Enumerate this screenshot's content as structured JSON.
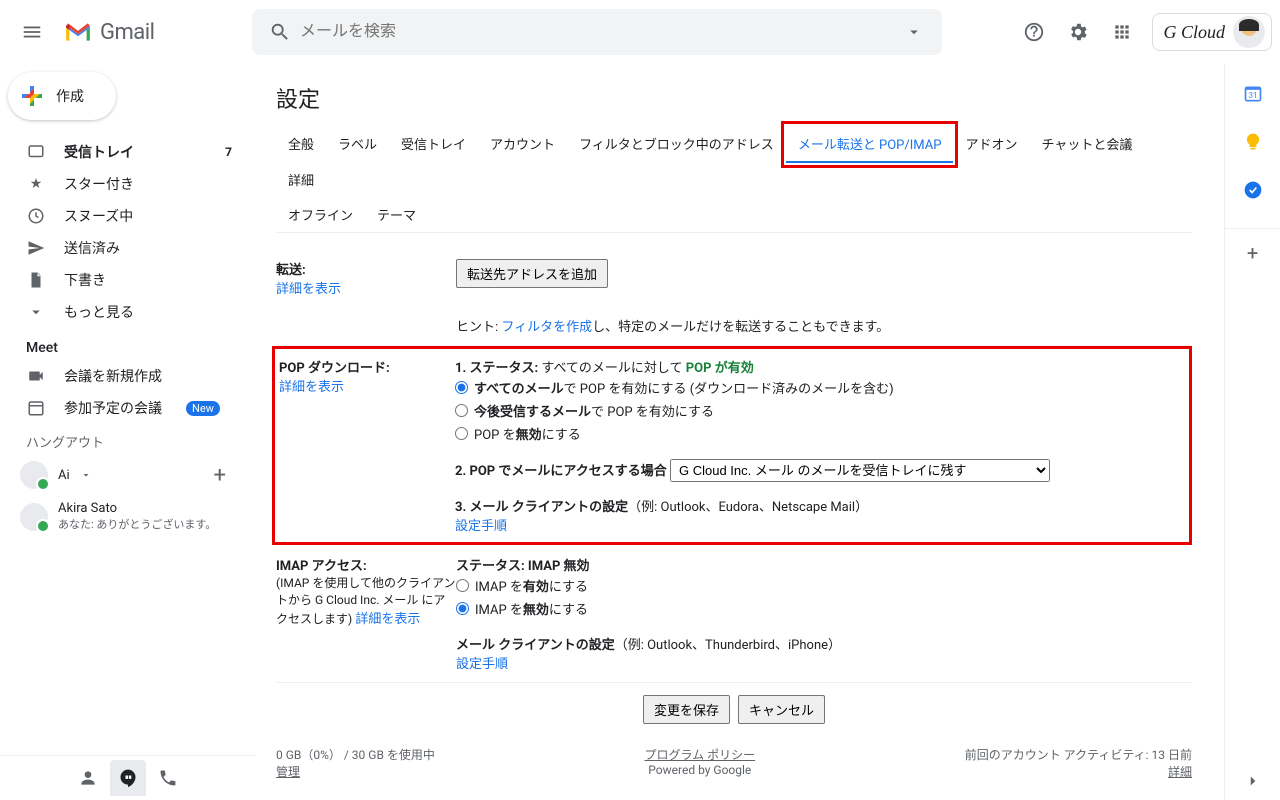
{
  "header": {
    "product": "Gmail",
    "search_placeholder": "メールを検索",
    "account_name": "G Cloud"
  },
  "sidebar": {
    "compose": "作成",
    "items": [
      {
        "icon": "inbox",
        "label": "受信トレイ",
        "count": "7",
        "bold": true
      },
      {
        "icon": "star",
        "label": "スター付き"
      },
      {
        "icon": "clock",
        "label": "スヌーズ中"
      },
      {
        "icon": "send",
        "label": "送信済み"
      },
      {
        "icon": "file",
        "label": "下書き"
      },
      {
        "icon": "chev",
        "label": "もっと見る"
      }
    ],
    "meet_title": "Meet",
    "meet_items": [
      {
        "icon": "video",
        "label": "会議を新規作成"
      },
      {
        "icon": "calendar",
        "label": "参加予定の会議",
        "new": true
      }
    ],
    "new_badge": "New",
    "hangouts_title": "ハングアウト",
    "hangout_self": {
      "name": "Ai"
    },
    "hangout_contact": {
      "name": "Akira Sato",
      "sub": "あなた: ありがとうございます。"
    }
  },
  "page": {
    "title": "設定",
    "tabs": [
      "全般",
      "ラベル",
      "受信トレイ",
      "アカウント",
      "フィルタとブロック中のアドレス",
      "メール転送と POP/IMAP",
      "アドオン",
      "チャットと会議",
      "詳細",
      "オフライン",
      "テーマ"
    ],
    "active_tab_index": 5
  },
  "forwarding": {
    "label": "転送:",
    "learn_more": "詳細を表示",
    "add_button": "転送先アドレスを追加",
    "hint_prefix": "ヒント: ",
    "hint_link": "フィルタを作成",
    "hint_suffix": "し、特定のメールだけを転送することもできます。"
  },
  "pop": {
    "label": "POP ダウンロード:",
    "learn_more": "詳細を表示",
    "status_label": "1. ステータス:",
    "status_prefix": "すべてのメールに対して ",
    "status_value": "POP が有効",
    "opt1_bold": "すべてのメール",
    "opt1_rest": "で POP を有効にする (ダウンロード済みのメールを含む)",
    "opt2_bold": "今後受信するメール",
    "opt2_rest": "で POP を有効にする",
    "opt3_pre": "POP を",
    "opt3_bold": "無効",
    "opt3_post": "にする",
    "access_label": "2. POP でメールにアクセスする場合",
    "dropdown_value": "G Cloud Inc. メール のメールを受信トレイに残す",
    "client_label": "3. メール クライアントの設定",
    "client_examples": "（例: Outlook、Eudora、Netscape Mail）",
    "instructions": "設定手順"
  },
  "imap": {
    "label": "IMAP アクセス:",
    "sub": "(IMAP を使用して他のクライアントから G Cloud Inc. メール にアクセスします)",
    "learn_more": "詳細を表示",
    "status_label": "ステータス:",
    "status_value": "IMAP 無効",
    "opt1_pre": "IMAP を",
    "opt1_bold": "有効",
    "opt1_post": "にする",
    "opt2_pre": "IMAP を",
    "opt2_bold": "無効",
    "opt2_post": "にする",
    "client_label": "メール クライアントの設定",
    "client_examples": "（例: Outlook、Thunderbird、iPhone）",
    "instructions": "設定手順"
  },
  "buttons": {
    "save": "変更を保存",
    "cancel": "キャンセル"
  },
  "footer": {
    "storage": "0 GB（0%） / 30 GB を使用中",
    "manage": "管理",
    "policy": "プログラム ポリシー",
    "powered": "Powered by Google",
    "activity": "前回のアカウント アクティビティ: 13 日前",
    "details": "詳細"
  }
}
